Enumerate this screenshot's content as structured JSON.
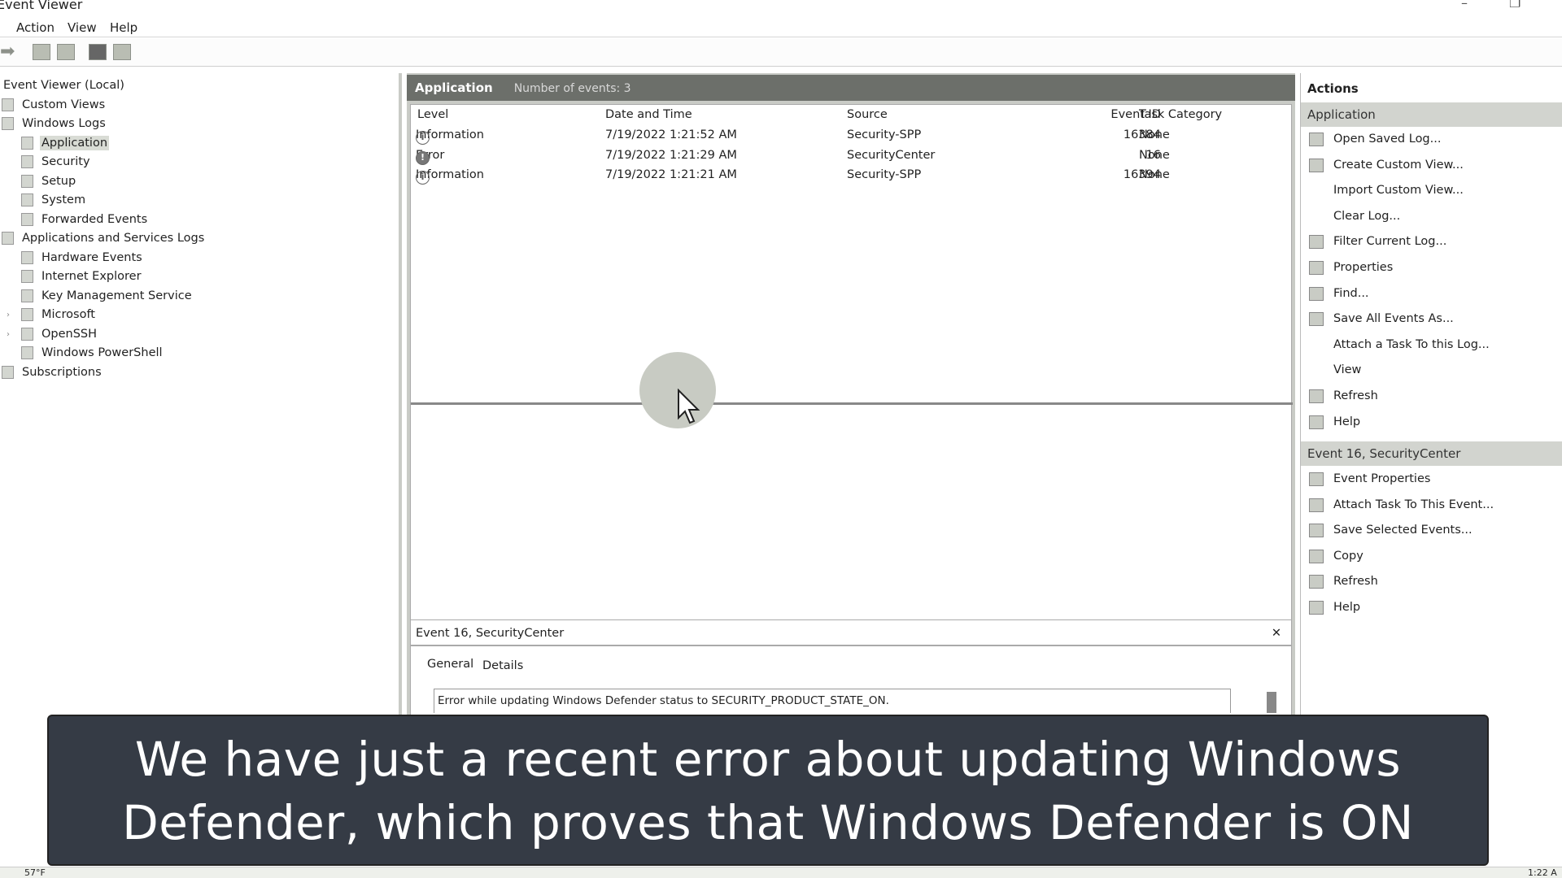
{
  "window": {
    "title": "Event Viewer",
    "minimize": "–",
    "restore": "❐"
  },
  "menu": [
    "Action",
    "View",
    "Help"
  ],
  "toolbar": [
    "forward-icon",
    "open-folder-icon",
    "properties-icon",
    "help-icon",
    "show-pane-icon"
  ],
  "tree": [
    {
      "label": "Event Viewer (Local)",
      "indent": 0,
      "icon": false
    },
    {
      "label": "Custom Views",
      "indent": 1
    },
    {
      "label": "Windows Logs",
      "indent": 1
    },
    {
      "label": "Application",
      "indent": 2,
      "selected": true
    },
    {
      "label": "Security",
      "indent": 2
    },
    {
      "label": "Setup",
      "indent": 2
    },
    {
      "label": "System",
      "indent": 2
    },
    {
      "label": "Forwarded Events",
      "indent": 2
    },
    {
      "label": "Applications and Services Logs",
      "indent": 1
    },
    {
      "label": "Hardware Events",
      "indent": 2
    },
    {
      "label": "Internet Explorer",
      "indent": 2
    },
    {
      "label": "Key Management Service",
      "indent": 2
    },
    {
      "label": "Microsoft",
      "indent": 2,
      "expander": true
    },
    {
      "label": "OpenSSH",
      "indent": 2,
      "expander": true
    },
    {
      "label": "Windows PowerShell",
      "indent": 2
    },
    {
      "label": "Subscriptions",
      "indent": 1
    }
  ],
  "log": {
    "name": "Application",
    "count_text": "Number of events: 3"
  },
  "columns": [
    "Level",
    "Date and Time",
    "Source",
    "Event ID",
    "Task Category"
  ],
  "events": [
    {
      "level": "Information",
      "icon": "info-icon",
      "date": "7/19/2022 1:21:52 AM",
      "source": "Security-SPP",
      "id": "16384",
      "task": "None"
    },
    {
      "level": "Error",
      "icon": "error-icon",
      "date": "7/19/2022 1:21:29 AM",
      "source": "SecurityCenter",
      "id": "16",
      "task": "None"
    },
    {
      "level": "Information",
      "icon": "info-icon",
      "date": "7/19/2022 1:21:21 AM",
      "source": "Security-SPP",
      "id": "16394",
      "task": "None"
    }
  ],
  "detail": {
    "title": "Event 16, SecurityCenter",
    "close": "✕",
    "tabs": [
      "General",
      "Details"
    ],
    "message": "Error while updating Windows Defender status to SECURITY_PRODUCT_STATE_ON."
  },
  "actions": {
    "header": "Actions",
    "section1": "Application",
    "items1": [
      {
        "label": "Open Saved Log...",
        "icon": true
      },
      {
        "label": "Create Custom View...",
        "icon": true
      },
      {
        "label": "Import Custom View...",
        "icon": false
      },
      {
        "label": "Clear Log...",
        "icon": false
      },
      {
        "label": "Filter Current Log...",
        "icon": true
      },
      {
        "label": "Properties",
        "icon": true
      },
      {
        "label": "Find...",
        "icon": true
      },
      {
        "label": "Save All Events As...",
        "icon": true
      },
      {
        "label": "Attach a Task To this Log...",
        "icon": false
      },
      {
        "label": "View",
        "icon": false
      },
      {
        "label": "Refresh",
        "icon": true
      },
      {
        "label": "Help",
        "icon": true
      }
    ],
    "section2": "Event 16, SecurityCenter",
    "items2": [
      {
        "label": "Event Properties",
        "icon": true
      },
      {
        "label": "Attach Task To This Event...",
        "icon": true
      },
      {
        "label": "Save Selected Events...",
        "icon": true
      },
      {
        "label": "Copy",
        "icon": true
      },
      {
        "label": "Refresh",
        "icon": true
      },
      {
        "label": "Help",
        "icon": true
      }
    ]
  },
  "subtitle": {
    "line1": "We have just a recent error about updating Windows",
    "line2": "Defender, which proves that Windows Defender is ON"
  },
  "taskbar": {
    "weather": "57°F",
    "clock": "1:22 A"
  }
}
